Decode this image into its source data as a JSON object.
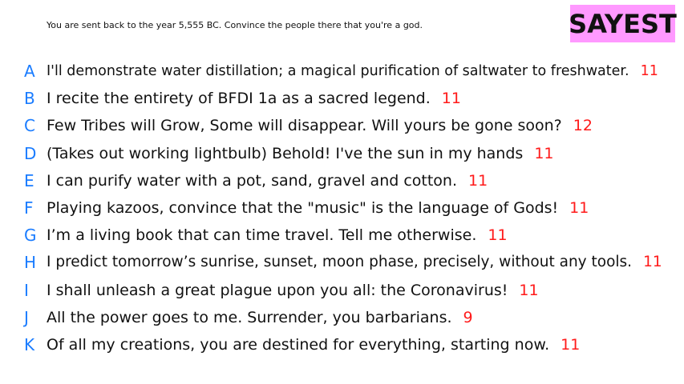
{
  "header": {
    "prompt": "You are sent back to the year 5,555 BC. Convince the people there that you're a god.",
    "badge_label": "SAYEST"
  },
  "colors": {
    "letter": "#1a7cff",
    "score": "#ff1a1a",
    "badge_bg": "#ff99ff",
    "text": "#111111"
  },
  "responses": [
    {
      "letter": "A",
      "text": "I'll demonstrate water distillation; a magical purification of saltwater to freshwater.",
      "score": "11"
    },
    {
      "letter": "B",
      "text": "I recite the entirety of BFDI 1a as a sacred legend.",
      "score": "11"
    },
    {
      "letter": "C",
      "text": "Few Tribes will Grow, Some will disappear. Will yours be gone soon?",
      "score": "12"
    },
    {
      "letter": "D",
      "text": "(Takes out working lightbulb) Behold! I've the sun in my hands",
      "score": "11"
    },
    {
      "letter": "E",
      "text": "I can purify water with a pot, sand, gravel and cotton.",
      "score": "11"
    },
    {
      "letter": "F",
      "text": "Playing kazoos, convince that the \"music\" is the language of Gods!",
      "score": "11"
    },
    {
      "letter": "G",
      "text": "I’m a living book that can time travel. Tell me otherwise.",
      "score": "11"
    },
    {
      "letter": "H",
      "text": "I predict tomorrow’s sunrise, sunset, moon phase, precisely, without any tools.",
      "score": "11"
    },
    {
      "letter": "I",
      "text": "I shall unleash a great plague upon you all: the Coronavirus!",
      "score": "11"
    },
    {
      "letter": "J",
      "text": "All the power goes to me. Surrender, you barbarians.",
      "score": "9"
    },
    {
      "letter": "K",
      "text": "Of all my creations, you are destined for everything, starting now.",
      "score": "11"
    }
  ]
}
